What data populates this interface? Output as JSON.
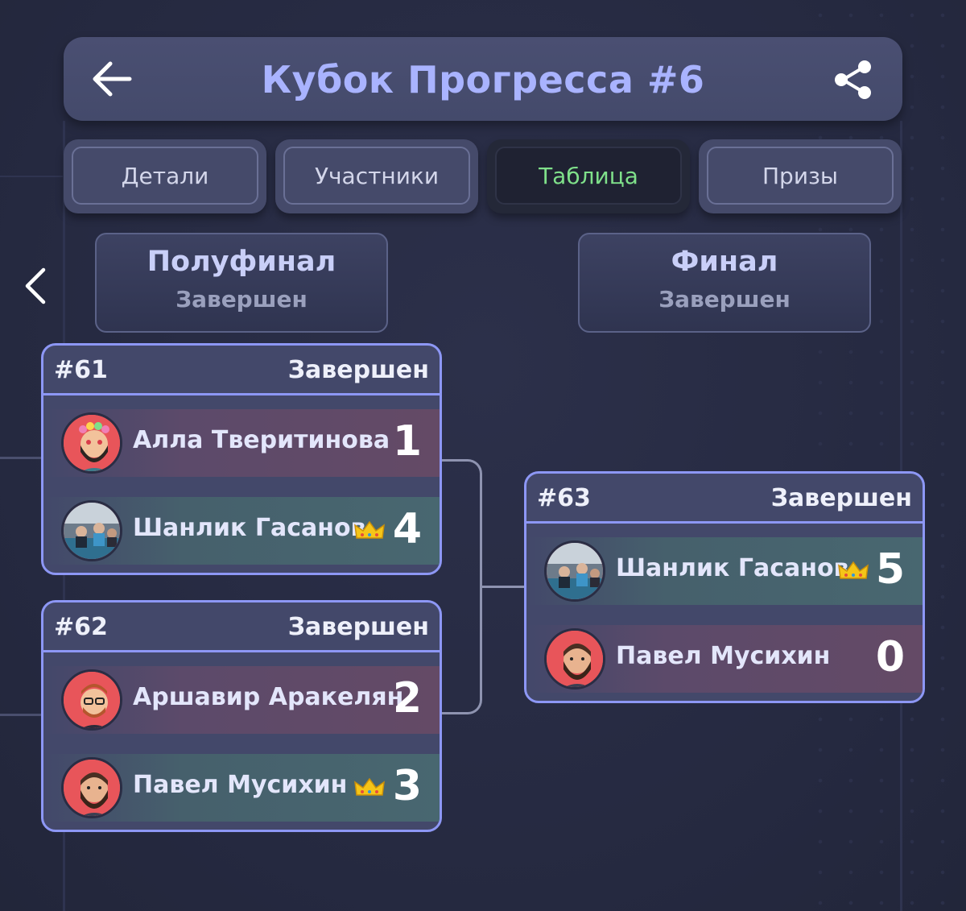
{
  "header": {
    "title": "Кубок Прогресса #6"
  },
  "tabs": [
    {
      "label": "Детали",
      "active": false
    },
    {
      "label": "Участники",
      "active": false
    },
    {
      "label": "Таблица",
      "active": true
    },
    {
      "label": "Призы",
      "active": false
    }
  ],
  "rounds": [
    {
      "name": "Полуфинал",
      "status": "Завершен"
    },
    {
      "name": "Финал",
      "status": "Завершен"
    }
  ],
  "matches": [
    {
      "id": "#61",
      "status": "Завершен",
      "players": [
        {
          "name": "Алла Тверитинова",
          "score": "1",
          "winner": false,
          "avatar": "avatar-flower-bearded-man"
        },
        {
          "name": "Шанлик Гасанов",
          "score": "4",
          "winner": true,
          "avatar": "avatar-photo"
        }
      ]
    },
    {
      "id": "#62",
      "status": "Завершен",
      "players": [
        {
          "name": "Аршавир Аракелян",
          "score": "2",
          "winner": false,
          "avatar": "avatar-glasses-man"
        },
        {
          "name": "Павел Мусихин",
          "score": "3",
          "winner": true,
          "avatar": "avatar-bearded-man"
        }
      ]
    },
    {
      "id": "#63",
      "status": "Завершен",
      "players": [
        {
          "name": "Шанлик Гасанов",
          "score": "5",
          "winner": true,
          "avatar": "avatar-photo"
        },
        {
          "name": "Павел Мусихин",
          "score": "0",
          "winner": false,
          "avatar": "avatar-bearded-man"
        }
      ]
    }
  ],
  "colors": {
    "accent": "#a9b3ff",
    "active_tab_text": "#7fe08a",
    "card_border": "#8d97f5",
    "crown": "#f5c518"
  }
}
